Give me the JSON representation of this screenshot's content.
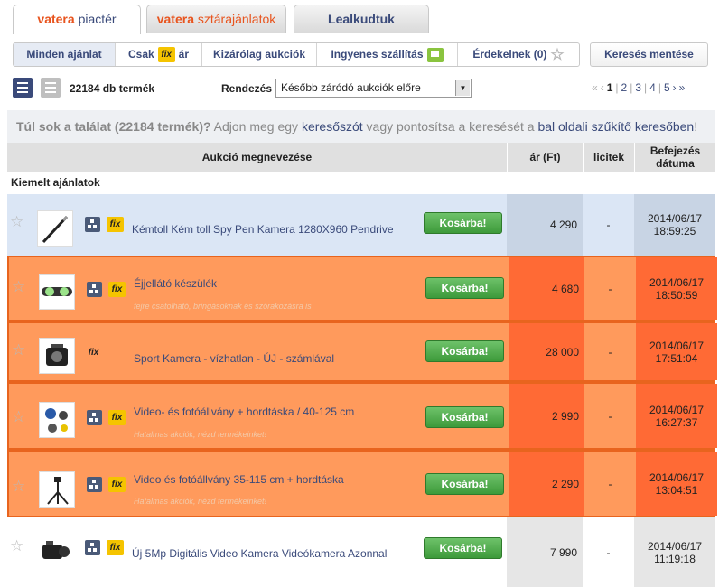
{
  "tabs": [
    {
      "brand": "vatera",
      "label": "piactér"
    },
    {
      "brand": "vatera",
      "label": "sztárajánlatok"
    },
    {
      "label": "Lealkudtuk"
    }
  ],
  "filters": {
    "all": "Minden ajánlat",
    "fix_prefix": "Csak",
    "fix_badge": "fix",
    "fix_suffix": "ár",
    "auction": "Kizárólag aukciók",
    "free_shipping": "Ingyenes szállítás",
    "interested": "Érdekelnek (0)"
  },
  "save_search": "Keresés mentése",
  "toolbar": {
    "count": "22184 db termék",
    "sort_label": "Rendezés",
    "sort_value": "Később záródó aukciók előre"
  },
  "pager": {
    "first": "«",
    "prev": "‹",
    "pages": [
      "1",
      "2",
      "3",
      "4",
      "5"
    ],
    "next": "›",
    "last": "»"
  },
  "notice": {
    "bold": "Túl sok a találat (22184 termék)?",
    "text1": " Adjon meg egy ",
    "link1": "keresőszót",
    "text2": " vagy pontosítsa a keresését a ",
    "link2": "bal oldali szűkítő keresőben",
    "text3": "!"
  },
  "table": {
    "col_name": "Aukció megnevezése",
    "col_price": "ár (Ft)",
    "col_bids": "licitek",
    "col_end_1": "Befejezés",
    "col_end_2": "dátuma",
    "featured_label": "Kiemelt ajánlatok",
    "cart_label": "Kosárba!"
  },
  "rows": [
    {
      "title": "Kémtoll Kém toll Spy Pen Kamera 1280X960 Pendrive",
      "subtitle": "",
      "price": "4 290",
      "bids": "-",
      "date": "2014/06/17",
      "time": "18:59:25",
      "style": "blue",
      "thumb": "pen"
    },
    {
      "title": "Éjjellátó készülék",
      "subtitle": "fejre csatolható, bringásoknak és szórakozásra is",
      "price": "4 680",
      "bids": "-",
      "date": "2014/06/17",
      "time": "18:50:59",
      "style": "orange",
      "thumb": "goggles"
    },
    {
      "title": "Sport Kamera - vízhatlan - ÚJ - számlával",
      "subtitle": "",
      "price": "28 000",
      "bids": "-",
      "date": "2014/06/17",
      "time": "17:51:04",
      "style": "orange",
      "thumb": "camera"
    },
    {
      "title": "Video- és fotóállvány + hordtáska / 40-125 cm",
      "subtitle": "Hatalmas akciók, nézd termékeinket!",
      "price": "2 990",
      "bids": "-",
      "date": "2014/06/17",
      "time": "16:27:37",
      "style": "orange",
      "thumb": "kit"
    },
    {
      "title": "Video és fotóállvány 35-115 cm + hordtáska",
      "subtitle": "Hatalmas akciók, nézd termékeinket!",
      "price": "2 290",
      "bids": "-",
      "date": "2014/06/17",
      "time": "13:04:51",
      "style": "orange",
      "thumb": "tripod"
    },
    {
      "title": "Új 5Mp Digitális Video Kamera Videókamera Azonnal",
      "subtitle": "",
      "price": "7 990",
      "bids": "-",
      "date": "2014/06/17",
      "time": "11:19:18",
      "style": "white",
      "thumb": "camcorder"
    }
  ]
}
